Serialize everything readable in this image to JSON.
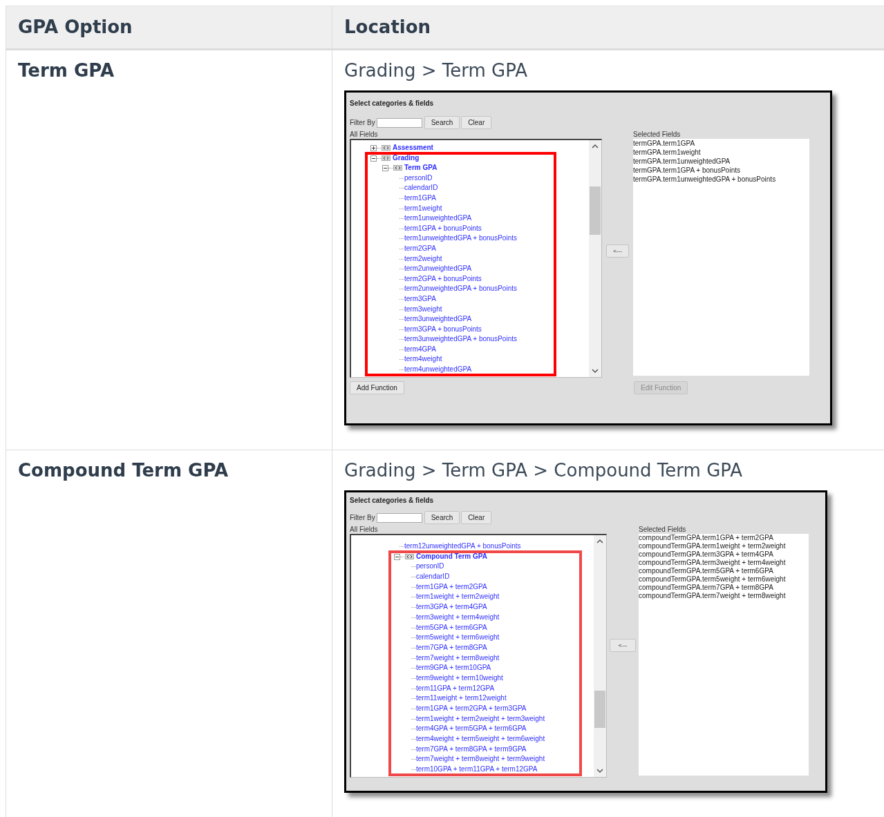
{
  "table": {
    "columns": [
      "GPA Option",
      "Location"
    ],
    "rows": [
      {
        "option": "Term GPA",
        "location": "Grading > Term GPA",
        "screenshot": {
          "title": "Select categories & fields",
          "filter_label": "Filter By",
          "search_button": "Search",
          "clear_button": "Clear",
          "all_fields_label": "All Fields",
          "move_button": "<---",
          "selected_label": "Selected Fields",
          "tree": [
            {
              "label": "Assessment",
              "kind": "category",
              "expanded": false,
              "highlighted": false
            },
            {
              "label": "Grading",
              "kind": "category",
              "expanded": true,
              "highlighted": true,
              "children": [
                {
                  "label": "Term GPA",
                  "kind": "category",
                  "expanded": true,
                  "highlighted": false,
                  "children": [
                    {
                      "label": "personID",
                      "kind": "field"
                    },
                    {
                      "label": "calendarID",
                      "kind": "field"
                    },
                    {
                      "label": "term1GPA",
                      "kind": "field"
                    },
                    {
                      "label": "term1weight",
                      "kind": "field"
                    },
                    {
                      "label": "term1unweightedGPA",
                      "kind": "field"
                    },
                    {
                      "label": "term1GPA + bonusPoints",
                      "kind": "field"
                    },
                    {
                      "label": "term1unweightedGPA + bonusPoints",
                      "kind": "field"
                    },
                    {
                      "label": "term2GPA",
                      "kind": "field"
                    },
                    {
                      "label": "term2weight",
                      "kind": "field"
                    },
                    {
                      "label": "term2unweightedGPA",
                      "kind": "field"
                    },
                    {
                      "label": "term2GPA + bonusPoints",
                      "kind": "field"
                    },
                    {
                      "label": "term2unweightedGPA + bonusPoints",
                      "kind": "field"
                    },
                    {
                      "label": "term3GPA",
                      "kind": "field"
                    },
                    {
                      "label": "term3weight",
                      "kind": "field"
                    },
                    {
                      "label": "term3unweightedGPA",
                      "kind": "field"
                    },
                    {
                      "label": "term3GPA + bonusPoints",
                      "kind": "field"
                    },
                    {
                      "label": "term3unweightedGPA + bonusPoints",
                      "kind": "field"
                    },
                    {
                      "label": "term4GPA",
                      "kind": "field"
                    },
                    {
                      "label": "term4weight",
                      "kind": "field"
                    },
                    {
                      "label": "term4unweightedGPA",
                      "kind": "field"
                    }
                  ]
                }
              ]
            }
          ],
          "selected_fields": [
            "termGPA.term1GPA",
            "termGPA.term1weight",
            "termGPA.term1unweightedGPA",
            "termGPA.term1GPA + bonusPoints",
            "termGPA.term1unweightedGPA + bonusPoints"
          ],
          "add_button": {
            "label": "Add Function",
            "disabled": false
          },
          "edit_button": {
            "label": "Edit Function",
            "disabled": true
          }
        }
      },
      {
        "option": "Compound Term GPA",
        "location": "Grading > Term GPA > Compound Term GPA",
        "screenshot": {
          "title": "Select categories & fields",
          "filter_label": "Filter By",
          "search_button": "Search",
          "clear_button": "Clear",
          "all_fields_label": "All Fields",
          "move_button": "<---",
          "selected_label": "Selected Fields",
          "tree": [
            {
              "label": "term12unweightedGPA + bonusPoints",
              "kind": "field"
            },
            {
              "label": "Compound Term GPA",
              "kind": "category",
              "expanded": true,
              "highlighted": true,
              "children": [
                {
                  "label": "personID",
                  "kind": "field"
                },
                {
                  "label": "calendarID",
                  "kind": "field"
                },
                {
                  "label": "term1GPA + term2GPA",
                  "kind": "field"
                },
                {
                  "label": "term1weight + term2weight",
                  "kind": "field"
                },
                {
                  "label": "term3GPA + term4GPA",
                  "kind": "field"
                },
                {
                  "label": "term3weight + term4weight",
                  "kind": "field"
                },
                {
                  "label": "term5GPA + term6GPA",
                  "kind": "field"
                },
                {
                  "label": "term5weight + term6weight",
                  "kind": "field"
                },
                {
                  "label": "term7GPA + term8GPA",
                  "kind": "field"
                },
                {
                  "label": "term7weight + term8weight",
                  "kind": "field"
                },
                {
                  "label": "term9GPA + term10GPA",
                  "kind": "field"
                },
                {
                  "label": "term9weight + term10weight",
                  "kind": "field"
                },
                {
                  "label": "term11GPA + term12GPA",
                  "kind": "field"
                },
                {
                  "label": "term11weight + term12weight",
                  "kind": "field"
                },
                {
                  "label": "term1GPA + term2GPA + term3GPA",
                  "kind": "field"
                },
                {
                  "label": "term1weight + term2weight + term3weight",
                  "kind": "field"
                },
                {
                  "label": "term4GPA + term5GPA + term6GPA",
                  "kind": "field"
                },
                {
                  "label": "term4weight + term5weight + term6weight",
                  "kind": "field"
                },
                {
                  "label": "term7GPA + term8GPA + term9GPA",
                  "kind": "field"
                },
                {
                  "label": "term7weight + term8weight + term9weight",
                  "kind": "field"
                },
                {
                  "label": "term10GPA + term11GPA + term12GPA",
                  "kind": "field"
                }
              ]
            }
          ],
          "selected_fields": [
            "compoundTermGPA.term1GPA + term2GPA",
            "compoundTermGPA.term1weight + term2weight",
            "compoundTermGPA.term3GPA + term4GPA",
            "compoundTermGPA.term3weight + term4weight",
            "compoundTermGPA.term5GPA + term6GPA",
            "compoundTermGPA.term5weight + term6weight",
            "compoundTermGPA.term7GPA + term8GPA",
            "compoundTermGPA.term7weight + term8weight"
          ]
        }
      }
    ]
  }
}
